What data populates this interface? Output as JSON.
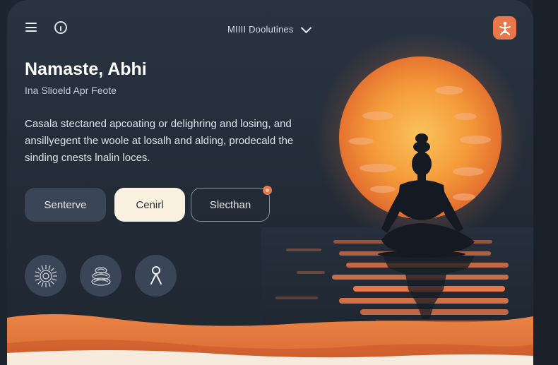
{
  "header": {
    "dropdown_label": "MIIII Doolutines"
  },
  "hero": {
    "greeting": "Namaste, Abhi",
    "subtitle": "Ina Slioeld Apr Feote",
    "description": "Casala stectaned apcoating or delighring and losing, and ansillyegent the woole at losalh and alding, prodecald the sinding cnests lnalin loces."
  },
  "buttons": [
    {
      "label": "Senterve"
    },
    {
      "label": "Cenirl"
    },
    {
      "label": "Slecthan"
    }
  ],
  "icons": {
    "menu": "hamburger-menu-icon",
    "info": "info-icon",
    "profile": "meditation-figure-icon",
    "quick_actions": [
      "sun-mandala-icon",
      "lotus-stone-icon",
      "ribbon-figure-icon"
    ]
  },
  "colors": {
    "background": "#222b36",
    "accent": "#e8784a",
    "sun": "#f39a3a",
    "button_light": "#fbf1e0"
  }
}
